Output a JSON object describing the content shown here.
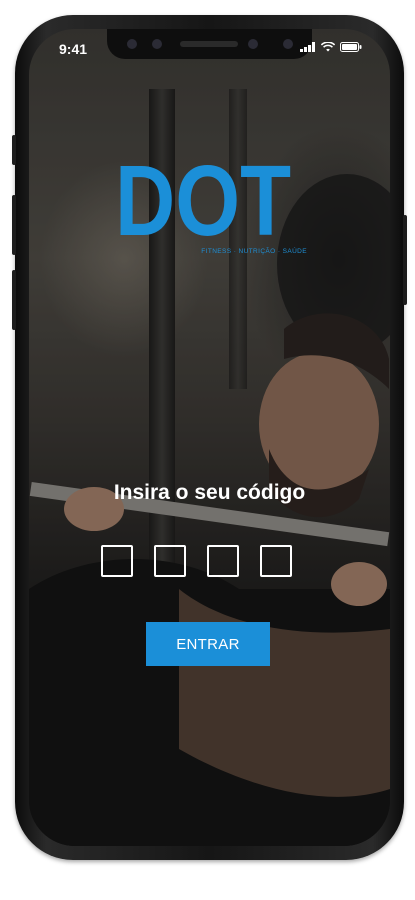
{
  "status_bar": {
    "time": "9:41"
  },
  "brand": {
    "name": "DOT",
    "tagline": "FITNESS · NUTRIÇÃO · SAÚDE",
    "color": "#1b8fd8"
  },
  "login": {
    "title": "Insira o seu código",
    "code_length": 4,
    "button_label": "ENTRAR"
  },
  "icons": [
    "signal-icon",
    "wifi-icon",
    "battery-icon"
  ]
}
